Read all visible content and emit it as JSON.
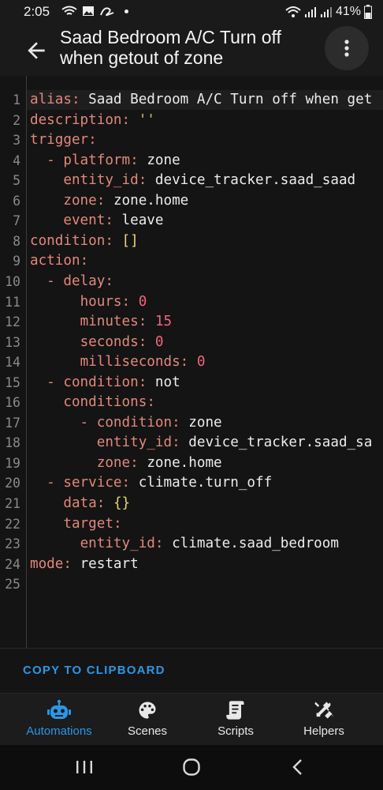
{
  "status_bar": {
    "time": "2:05",
    "battery": "41%",
    "icons": [
      "wifi-calling-icon",
      "gallery-icon",
      "app-icon",
      "dot-icon",
      "wifi-icon",
      "signal-icon",
      "signal-icon",
      "battery-icon"
    ]
  },
  "header": {
    "title_line1": "Saad Bedroom A/C Turn off",
    "title_line2": "when getout of zone",
    "back_icon": "arrow-left-icon",
    "menu_icon": "more-vert-icon"
  },
  "editor": {
    "line_numbers": [
      "1",
      "2",
      "3",
      "4",
      "5",
      "6",
      "7",
      "8",
      "9",
      "10",
      "11",
      "12",
      "13",
      "14",
      "15",
      "16",
      "17",
      "18",
      "19",
      "20",
      "21",
      "22",
      "23",
      "24",
      "25"
    ],
    "lines": [
      {
        "indent": "",
        "key": "alias",
        "sep": ": ",
        "value": "Saad Bedroom A/C Turn off when get",
        "vtype": "v"
      },
      {
        "indent": "",
        "key": "description",
        "sep": ": ",
        "value": "''",
        "vtype": "s"
      },
      {
        "indent": "",
        "key": "trigger",
        "sep": ":",
        "value": "",
        "vtype": "v"
      },
      {
        "indent": "  - ",
        "key": "platform",
        "sep": ": ",
        "value": "zone",
        "vtype": "v"
      },
      {
        "indent": "    ",
        "key": "entity_id",
        "sep": ": ",
        "value": "device_tracker.saad_saad",
        "vtype": "v"
      },
      {
        "indent": "    ",
        "key": "zone",
        "sep": ": ",
        "value": "zone.home",
        "vtype": "v"
      },
      {
        "indent": "    ",
        "key": "event",
        "sep": ": ",
        "value": "leave",
        "vtype": "v"
      },
      {
        "indent": "",
        "key": "condition",
        "sep": ": ",
        "value": "[]",
        "vtype": "b"
      },
      {
        "indent": "",
        "key": "action",
        "sep": ":",
        "value": "",
        "vtype": "v"
      },
      {
        "indent": "  - ",
        "key": "delay",
        "sep": ":",
        "value": "",
        "vtype": "v"
      },
      {
        "indent": "      ",
        "key": "hours",
        "sep": ": ",
        "value": "0",
        "vtype": "n"
      },
      {
        "indent": "      ",
        "key": "minutes",
        "sep": ": ",
        "value": "15",
        "vtype": "n"
      },
      {
        "indent": "      ",
        "key": "seconds",
        "sep": ": ",
        "value": "0",
        "vtype": "n"
      },
      {
        "indent": "      ",
        "key": "milliseconds",
        "sep": ": ",
        "value": "0",
        "vtype": "n"
      },
      {
        "indent": "  - ",
        "key": "condition",
        "sep": ": ",
        "value": "not",
        "vtype": "v"
      },
      {
        "indent": "    ",
        "key": "conditions",
        "sep": ":",
        "value": "",
        "vtype": "v"
      },
      {
        "indent": "      - ",
        "key": "condition",
        "sep": ": ",
        "value": "zone",
        "vtype": "v"
      },
      {
        "indent": "        ",
        "key": "entity_id",
        "sep": ": ",
        "value": "device_tracker.saad_sa",
        "vtype": "v"
      },
      {
        "indent": "        ",
        "key": "zone",
        "sep": ": ",
        "value": "zone.home",
        "vtype": "v"
      },
      {
        "indent": "  - ",
        "key": "service",
        "sep": ": ",
        "value": "climate.turn_off",
        "vtype": "v"
      },
      {
        "indent": "    ",
        "key": "data",
        "sep": ": ",
        "value": "{}",
        "vtype": "b"
      },
      {
        "indent": "    ",
        "key": "target",
        "sep": ":",
        "value": "",
        "vtype": "v"
      },
      {
        "indent": "      ",
        "key": "entity_id",
        "sep": ": ",
        "value": "climate.saad_bedroom",
        "vtype": "v"
      },
      {
        "indent": "",
        "key": "mode",
        "sep": ": ",
        "value": "restart",
        "vtype": "v"
      },
      {
        "indent": "",
        "key": "",
        "sep": "",
        "value": "",
        "vtype": "v"
      }
    ]
  },
  "copy_button": "COPY TO CLIPBOARD",
  "bottom_nav": {
    "items": [
      {
        "label": "Automations",
        "icon": "robot-icon",
        "active": true
      },
      {
        "label": "Scenes",
        "icon": "palette-icon",
        "active": false
      },
      {
        "label": "Scripts",
        "icon": "script-icon",
        "active": false
      },
      {
        "label": "Helpers",
        "icon": "tools-icon",
        "active": false
      }
    ]
  },
  "system_nav": [
    "recent-apps-icon",
    "home-icon",
    "back-icon"
  ],
  "colors": {
    "accent": "#2a97e6",
    "yaml_key": "#e3887a",
    "yaml_number": "#f0657e",
    "yaml_string": "#d8bb7a",
    "yaml_bracket": "#f2d46a",
    "background": "#141414"
  }
}
